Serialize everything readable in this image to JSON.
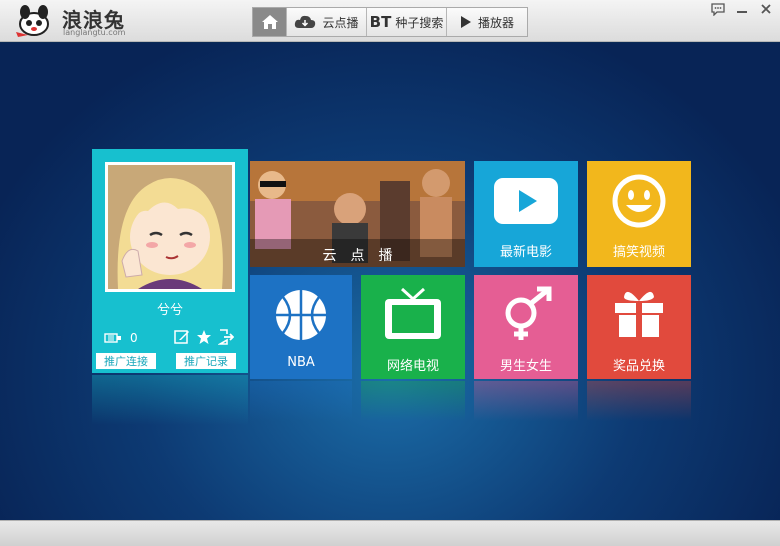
{
  "titlebar": {
    "app_name": "浪浪兔",
    "app_url": "langlangtu.com",
    "nav": {
      "cloud_label": "云点播",
      "bt_mark": "BT",
      "bt_label": "种子搜索",
      "player_label": "播放器"
    }
  },
  "profile": {
    "username": "兮兮",
    "coins": "0",
    "promo_link_label": "推广连接",
    "promo_record_label": "推广记录"
  },
  "tiles": {
    "cloud": "云点播",
    "movies": "最新电影",
    "funny": "搞笑视频",
    "nba": "NBA",
    "tv": "网络电视",
    "gender": "男生女生",
    "prize": "奖品兑换"
  },
  "colors": {
    "profile": "#17c0cf",
    "movies": "#17a6d8",
    "funny": "#f2b71c",
    "nba": "#1d72c4",
    "tv": "#19b14b",
    "gender": "#e55e94",
    "prize": "#e14a3d"
  },
  "icons": {
    "home": "home-icon",
    "cloud": "cloud-icon",
    "player": "play-icon",
    "feedback": "chat-icon",
    "minimize": "minimize-icon",
    "close": "close-icon",
    "coin": "coin-icon",
    "edit": "edit-icon",
    "favorite": "star-icon",
    "logout": "logout-icon",
    "movies": "play-button-icon",
    "funny": "smiley-icon",
    "nba": "basketball-icon",
    "tv": "tv-icon",
    "gender": "gender-icon",
    "prize": "gift-icon"
  }
}
